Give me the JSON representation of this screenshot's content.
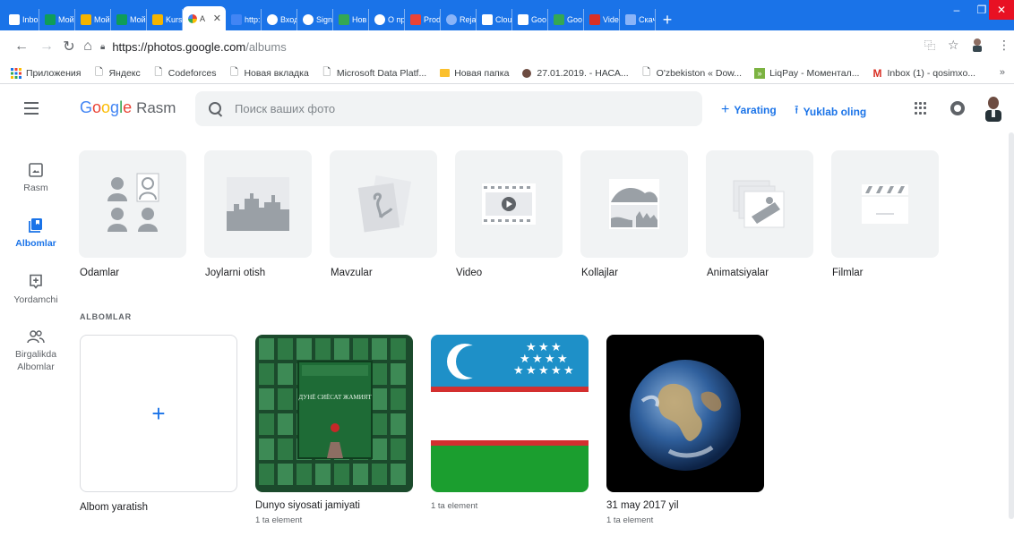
{
  "browser": {
    "tabs": [
      {
        "label": "Inbo",
        "color": "#d93025"
      },
      {
        "label": "Мой",
        "color": "#0f9d58"
      },
      {
        "label": "Мой",
        "color": "#f4b400"
      },
      {
        "label": "Мой",
        "color": "#0f9d58"
      },
      {
        "label": "Kurs",
        "color": "#f4b400"
      },
      {
        "label": "A",
        "color": "#ea4335",
        "active": true
      },
      {
        "label": "http:",
        "color": "#4285f4"
      },
      {
        "label": "Вход",
        "color": "#4285f4"
      },
      {
        "label": "Sign",
        "color": "#4285f4"
      },
      {
        "label": "Нов",
        "color": "#34a853"
      },
      {
        "label": "О пр",
        "color": "#4285f4"
      },
      {
        "label": "Prod",
        "color": "#ea4335"
      },
      {
        "label": "Reja",
        "color": "#8ab4f8"
      },
      {
        "label": "Clou",
        "color": "#1a73e8"
      },
      {
        "label": "Goo",
        "color": "#1a73e8"
      },
      {
        "label": "Goo",
        "color": "#34a853"
      },
      {
        "label": "Vide",
        "color": "#d93025"
      },
      {
        "label": "Скач",
        "color": "#8ab4f8"
      }
    ],
    "new_tab": "+",
    "url_host": "https://photos.google.com",
    "url_path": "/albums",
    "bookmarks": [
      {
        "label": "Приложения",
        "icon": "apps-icon"
      },
      {
        "label": "Яндекс",
        "icon": "page-icon"
      },
      {
        "label": "Codeforces",
        "icon": "page-icon"
      },
      {
        "label": "Новая вкладка",
        "icon": "page-icon"
      },
      {
        "label": "Microsoft Data Platf...",
        "icon": "page-icon"
      },
      {
        "label": "Новая папка",
        "icon": "folder-icon"
      },
      {
        "label": "27.01.2019. - НАСА...",
        "icon": "globe-icon"
      },
      {
        "label": "O'zbekiston « Dow...",
        "icon": "page-icon"
      },
      {
        "label": "LiqPay - Моментал...",
        "icon": "liqpay-icon"
      },
      {
        "label": "Inbox (1) - qosimxo...",
        "icon": "gmail-icon"
      }
    ],
    "bookmarks_more": "»"
  },
  "header": {
    "logo_google": "Google",
    "logo_product": "Rasm",
    "search_placeholder": "Поиск ваших фото",
    "create_label": "Yarating",
    "upload_label": "Yuklab oling"
  },
  "nav": {
    "items": [
      {
        "label": "Rasm"
      },
      {
        "label": "Albomlar",
        "active": true
      },
      {
        "label": "Yordamchi"
      },
      {
        "label": "Birgalikda Albomlar"
      }
    ]
  },
  "categories": [
    {
      "label": "Odamlar",
      "icon": "people-icon"
    },
    {
      "label": "Joylarni otish",
      "icon": "places-icon"
    },
    {
      "label": "Mavzular",
      "icon": "things-icon"
    },
    {
      "label": "Video",
      "icon": "video-icon"
    },
    {
      "label": "Kollajlar",
      "icon": "collage-icon"
    },
    {
      "label": "Animatsiyalar",
      "icon": "animation-icon"
    },
    {
      "label": "Filmlar",
      "icon": "movie-icon"
    }
  ],
  "albums_section_title": "ALBOMLAR",
  "albums": [
    {
      "title": "Albom yaratish",
      "subtitle": ""
    },
    {
      "title": "Dunyo siyosati jamiyati",
      "subtitle": "1 ta element",
      "cover_text": "ДУНЁ СИЁСАТ ЖАМИЯТ"
    },
    {
      "title": "",
      "subtitle": "1 ta element"
    },
    {
      "title": "31 may 2017 yil",
      "subtitle": "1 ta element"
    }
  ],
  "colors": {
    "accent": "#1a73e8",
    "tab_bar": "#1a73e8",
    "card_bg": "#f1f3f4"
  }
}
